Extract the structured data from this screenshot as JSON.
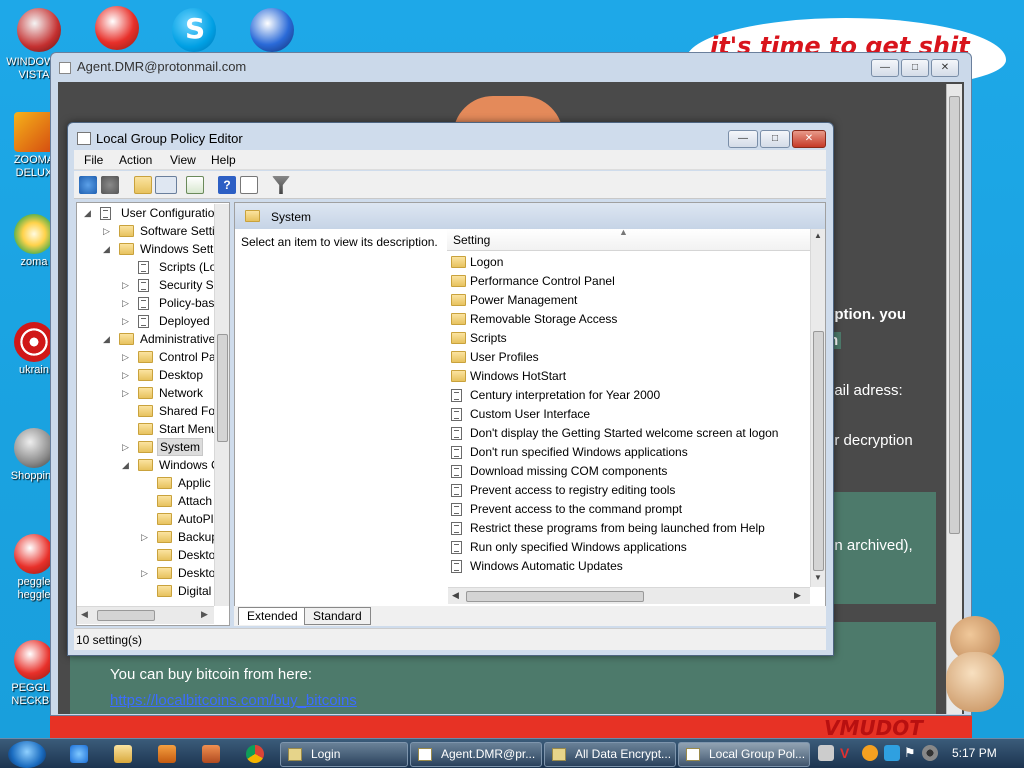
{
  "desktop": {
    "icons": [
      {
        "label": "WINDOWS VISTA"
      },
      {
        "label": "ZOOMA DELUX"
      },
      {
        "label": "zoma"
      },
      {
        "label": "ukrain"
      },
      {
        "label": "Shopping"
      },
      {
        "label": "peggle heggle"
      },
      {
        "label": "PEGGLE NECKBE"
      }
    ],
    "banner_text": "it's time to get shit"
  },
  "outer_window": {
    "title": "Agent.DMR@protonmail.com",
    "text_lines": [
      "yption. you",
      "n",
      "nail adress:",
      "ur decryption",
      "on archived),",
      "You can buy bitcoin from here:",
      "https://localbitcoins.com/buy_bitcoins"
    ],
    "brand_text": "VMUDOT"
  },
  "gpedit": {
    "title": "Local Group Policy Editor",
    "menu": [
      "File",
      "Action",
      "View",
      "Help"
    ],
    "toolbar_icons": [
      "back-icon",
      "forward-icon",
      "up-folder-icon",
      "show-hide-tree-icon",
      "export-list-icon",
      "help-icon",
      "properties-icon",
      "filter-icon"
    ],
    "tree": [
      {
        "label": "User Configuratio",
        "level": 0,
        "expander": "open",
        "icon": "user-config"
      },
      {
        "label": "Software Setti",
        "level": 1,
        "expander": "closed",
        "icon": "folder"
      },
      {
        "label": "Windows Sett",
        "level": 1,
        "expander": "open",
        "icon": "folder"
      },
      {
        "label": "Scripts (Lo",
        "level": 2,
        "expander": "none",
        "icon": "scripts"
      },
      {
        "label": "Security Se",
        "level": 2,
        "expander": "closed",
        "icon": "security"
      },
      {
        "label": "Policy-bas",
        "level": 2,
        "expander": "closed",
        "icon": "chart"
      },
      {
        "label": "Deployed",
        "level": 2,
        "expander": "closed",
        "icon": "printer"
      },
      {
        "label": "Administrative",
        "level": 1,
        "expander": "open",
        "icon": "folder"
      },
      {
        "label": "Control Pa",
        "level": 2,
        "expander": "closed",
        "icon": "folder"
      },
      {
        "label": "Desktop",
        "level": 2,
        "expander": "closed",
        "icon": "folder"
      },
      {
        "label": "Network",
        "level": 2,
        "expander": "closed",
        "icon": "folder"
      },
      {
        "label": "Shared Fol",
        "level": 2,
        "expander": "none",
        "icon": "folder"
      },
      {
        "label": "Start Menu",
        "level": 2,
        "expander": "none",
        "icon": "folder"
      },
      {
        "label": "System",
        "level": 2,
        "expander": "closed",
        "icon": "folder",
        "selected": true
      },
      {
        "label": "Windows C",
        "level": 2,
        "expander": "open",
        "icon": "folder"
      },
      {
        "label": "Applic",
        "level": 3,
        "expander": "none",
        "icon": "folder"
      },
      {
        "label": "Attach",
        "level": 3,
        "expander": "none",
        "icon": "folder"
      },
      {
        "label": "AutoPl",
        "level": 3,
        "expander": "none",
        "icon": "folder"
      },
      {
        "label": "Backup",
        "level": 3,
        "expander": "closed",
        "icon": "folder"
      },
      {
        "label": "Deskto",
        "level": 3,
        "expander": "none",
        "icon": "folder"
      },
      {
        "label": "Deskto",
        "level": 3,
        "expander": "closed",
        "icon": "folder"
      },
      {
        "label": "Digital",
        "level": 3,
        "expander": "none",
        "icon": "folder"
      }
    ],
    "header_folder": "System",
    "description": "Select an item to view its description.",
    "column_header": "Setting",
    "settings": [
      {
        "label": "Logon",
        "type": "folder"
      },
      {
        "label": "Performance Control Panel",
        "type": "folder"
      },
      {
        "label": "Power Management",
        "type": "folder"
      },
      {
        "label": "Removable Storage Access",
        "type": "folder"
      },
      {
        "label": "Scripts",
        "type": "folder"
      },
      {
        "label": "User Profiles",
        "type": "folder"
      },
      {
        "label": "Windows HotStart",
        "type": "folder"
      },
      {
        "label": "Century interpretation for Year 2000",
        "type": "policy"
      },
      {
        "label": "Custom User Interface",
        "type": "policy"
      },
      {
        "label": "Don't display the Getting Started welcome screen at logon",
        "type": "policy"
      },
      {
        "label": "Don't run specified Windows applications",
        "type": "policy"
      },
      {
        "label": "Download missing COM components",
        "type": "policy"
      },
      {
        "label": "Prevent access to registry editing tools",
        "type": "policy"
      },
      {
        "label": "Prevent access to the command prompt",
        "type": "policy"
      },
      {
        "label": "Restrict these programs from being launched from Help",
        "type": "policy"
      },
      {
        "label": "Run only specified Windows applications",
        "type": "policy"
      },
      {
        "label": "Windows Automatic Updates",
        "type": "policy"
      }
    ],
    "tabs": [
      "Extended",
      "Standard"
    ],
    "active_tab": "Extended",
    "status": "10 setting(s)"
  },
  "taskbar": {
    "items": [
      "Login",
      "Agent.DMR@pr...",
      "All Data Encrypt...",
      "Local Group Pol..."
    ],
    "active_item": "Local Group Pol...",
    "clock": "5:17 PM"
  }
}
